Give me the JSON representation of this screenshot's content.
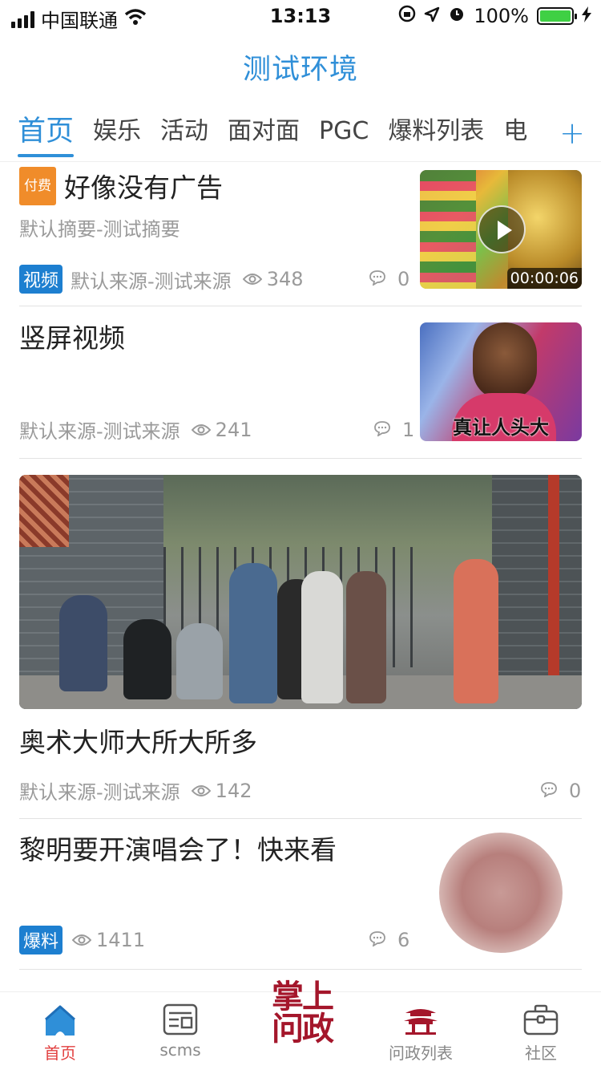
{
  "status_bar": {
    "carrier": "中国联通",
    "time": "13:13",
    "battery": "100%"
  },
  "header": {
    "title": "测试环境"
  },
  "tabs": [
    "首页",
    "娱乐",
    "活动",
    "面对面",
    "PGC",
    "爆料列表",
    "电"
  ],
  "feed": [
    {
      "tag": "付费",
      "title": "好像没有广告",
      "summary": "默认摘要-测试摘要",
      "label": "视频",
      "source": "默认来源-测试来源",
      "views": "348",
      "comments": "0",
      "thumb_duration": "00:00:06"
    },
    {
      "title": "竖屏视频",
      "source": "默认来源-测试来源",
      "views": "241",
      "comments": "1",
      "thumb_caption": "真让人头大"
    },
    {
      "title": "奥术大师大所大所多",
      "source": "默认来源-测试来源",
      "views": "142",
      "comments": "0"
    },
    {
      "title": "黎明要开演唱会了！快来看",
      "label": "爆料",
      "views": "1411",
      "comments": "6"
    }
  ],
  "tabbar": {
    "items": [
      "首页",
      "scms",
      "问政列表",
      "社区"
    ],
    "center_logo": "掌上问政"
  },
  "colors": {
    "accent": "#2f8fd8",
    "active_tab_label": "#e24040",
    "brand_red": "#a4162b",
    "paid_tag": "#f08c2a"
  }
}
